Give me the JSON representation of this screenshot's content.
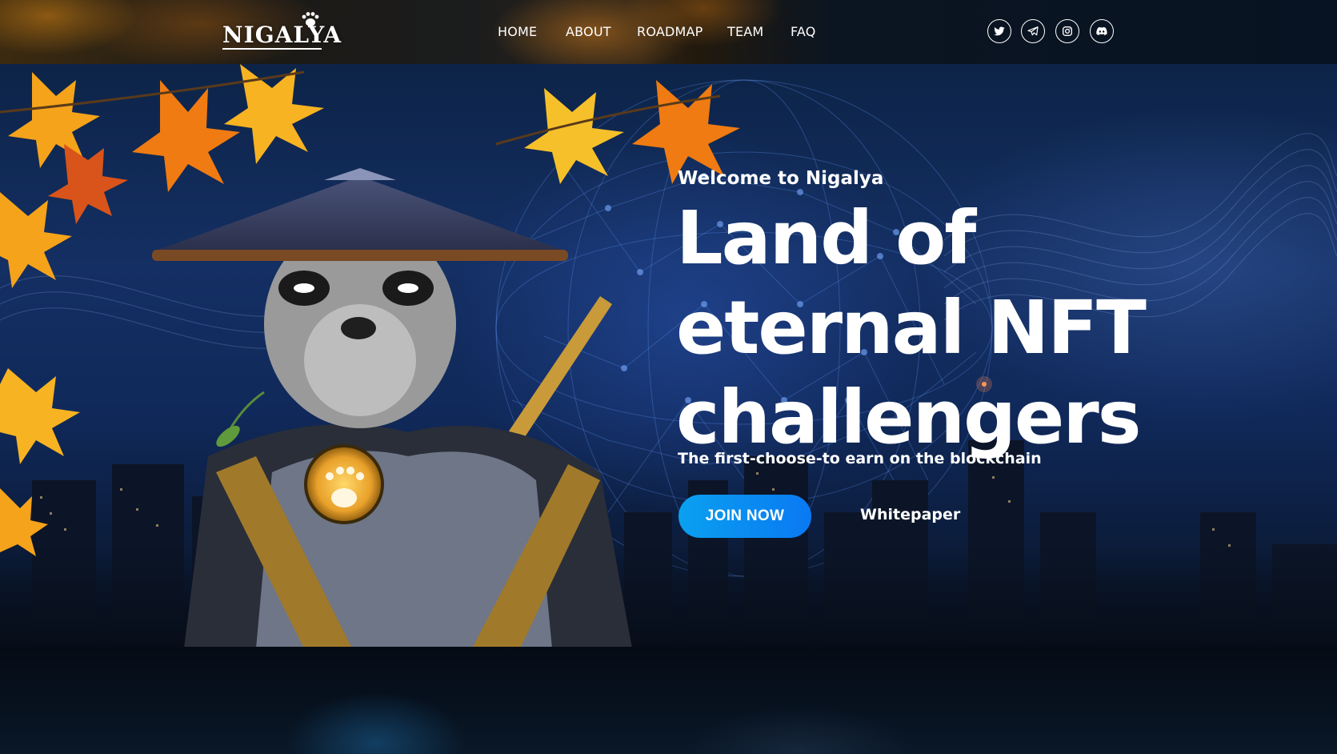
{
  "header": {
    "logo_text": "NIGALYA",
    "nav": [
      "HOME",
      "ABOUT",
      "ROADMAP",
      "TEAM",
      "FAQ"
    ],
    "socials": [
      "twitter-icon",
      "telegram-icon",
      "instagram-icon",
      "discord-icon"
    ]
  },
  "hero": {
    "welcome": "Welcome to Nigalya",
    "headline": [
      "Land of",
      "eternal NFT",
      "challengers"
    ],
    "subtitle": "The first-choose-to earn on the blockchain",
    "join_button": "JOIN NOW",
    "whitepaper_link": "Whitepaper"
  },
  "colors": {
    "accent": "#0a8ef2",
    "background": "#10295a",
    "text": "#ffffff"
  }
}
